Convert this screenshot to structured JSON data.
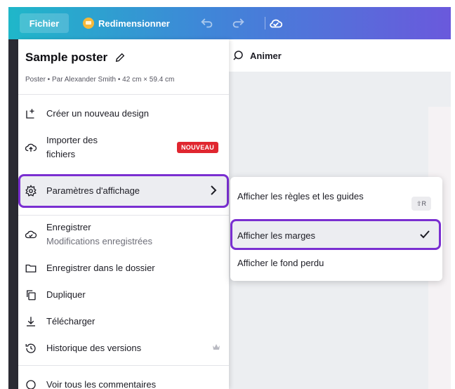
{
  "topbar": {
    "file_label": "Fichier",
    "resize_label": "Redimensionner",
    "undo_icon": "undo-icon",
    "redo_icon": "redo-icon",
    "cloud_icon": "cloud-sync-icon"
  },
  "editor": {
    "animate_label": "Animer",
    "animate_icon": "animate-icon"
  },
  "menu": {
    "title": "Sample poster",
    "edit_icon": "pencil-icon",
    "subtitle": "Poster • Par Alexander Smith • 42 cm × 59.4 cm",
    "items": [
      {
        "label": "Créer un nouveau design",
        "icon": "new-design-icon"
      },
      {
        "label": "Importer des fichiers",
        "icon": "upload-cloud-icon",
        "badge": "NOUVEAU"
      },
      {
        "label": "Paramètres d'affichage",
        "icon": "gear-icon"
      },
      {
        "label": "Enregistrer",
        "sublabel": "Modifications enregistrées",
        "icon": "saved-check-icon"
      },
      {
        "label": "Enregistrer dans le dossier",
        "icon": "folder-icon"
      },
      {
        "label": "Dupliquer",
        "icon": "duplicate-icon"
      },
      {
        "label": "Télécharger",
        "icon": "download-icon"
      },
      {
        "label": "Historique des versions",
        "icon": "history-icon"
      },
      {
        "label": "Voir tous les commentaires",
        "icon": "comment-icon"
      }
    ]
  },
  "submenu": {
    "items": [
      {
        "label": "Afficher les règles et les guides",
        "shortcut": "⇧R"
      },
      {
        "label": "Afficher les marges",
        "checked": true
      },
      {
        "label": "Afficher le fond perdu"
      }
    ]
  },
  "colors": {
    "highlight_border": "#7a2fd1",
    "badge_red": "#e0262f",
    "topbar_start": "#1fb7c9",
    "topbar_end": "#6a59dc"
  }
}
